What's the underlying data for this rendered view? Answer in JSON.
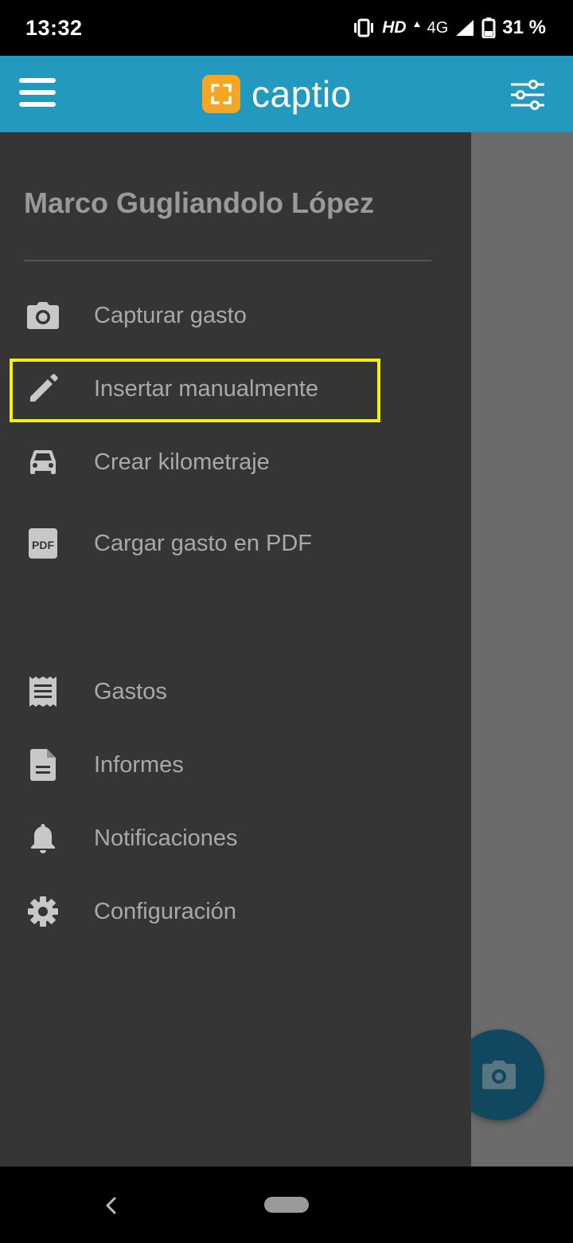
{
  "status_bar": {
    "time": "13:32",
    "hd": "HD",
    "network": "4G",
    "battery": "31 %"
  },
  "app_bar": {
    "logo_text": "captio",
    "brand_color": "#2399bf",
    "logo_color": "#f5a623"
  },
  "drawer": {
    "user_name": "Marco Gugliandolo López",
    "items": [
      {
        "label": "Capturar gasto",
        "icon": "camera-icon"
      },
      {
        "label": "Insertar manualmente",
        "icon": "pencil-icon"
      },
      {
        "label": "Crear kilometraje",
        "icon": "car-icon"
      },
      {
        "label": "Cargar gasto en PDF",
        "icon": "pdf-icon",
        "icon_text": "PDF"
      },
      {
        "label": "Gastos",
        "icon": "receipt-icon"
      },
      {
        "label": "Informes",
        "icon": "document-icon"
      },
      {
        "label": "Notificaciones",
        "icon": "bell-icon"
      },
      {
        "label": "Configuración",
        "icon": "gear-icon"
      }
    ]
  }
}
